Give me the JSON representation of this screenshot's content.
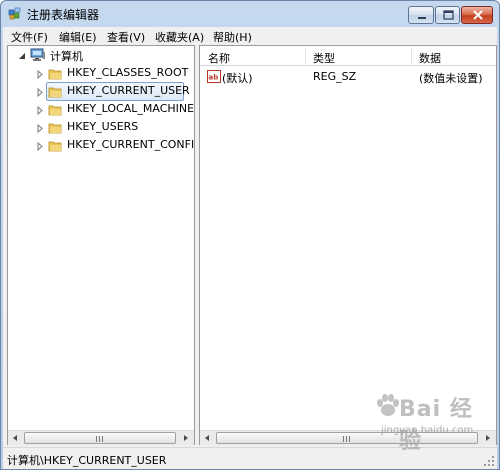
{
  "window": {
    "title": "注册表编辑器"
  },
  "menu": {
    "items": [
      {
        "label": "文件(F)"
      },
      {
        "label": "编辑(E)"
      },
      {
        "label": "查看(V)"
      },
      {
        "label": "收藏夹(A)"
      },
      {
        "label": "帮助(H)"
      }
    ]
  },
  "tree": {
    "root": {
      "label": "计算机",
      "icon": "computer-icon",
      "expanded": true
    },
    "items": [
      {
        "label": "HKEY_CLASSES_ROOT",
        "icon": "folder-icon"
      },
      {
        "label": "HKEY_CURRENT_USER",
        "icon": "folder-icon",
        "selected": true
      },
      {
        "label": "HKEY_LOCAL_MACHINE",
        "icon": "folder-icon"
      },
      {
        "label": "HKEY_USERS",
        "icon": "folder-icon"
      },
      {
        "label": "HKEY_CURRENT_CONFIG",
        "icon": "folder-icon"
      }
    ]
  },
  "list": {
    "columns": [
      {
        "label": "名称"
      },
      {
        "label": "类型"
      },
      {
        "label": "数据"
      }
    ],
    "rows": [
      {
        "name": "(默认)",
        "type": "REG_SZ",
        "data": "(数值未设置)",
        "icon": "string-value-icon"
      }
    ]
  },
  "status": {
    "path": "计算机\\HKEY_CURRENT_USER"
  },
  "watermark": {
    "main": "Bai 经验",
    "sub": "jingyan.baidu.com"
  },
  "colors": {
    "frame": "#c5d8ee",
    "selection_border": "#7da2ce",
    "folder": "#e8c65a",
    "close_button": "#c2401d"
  }
}
